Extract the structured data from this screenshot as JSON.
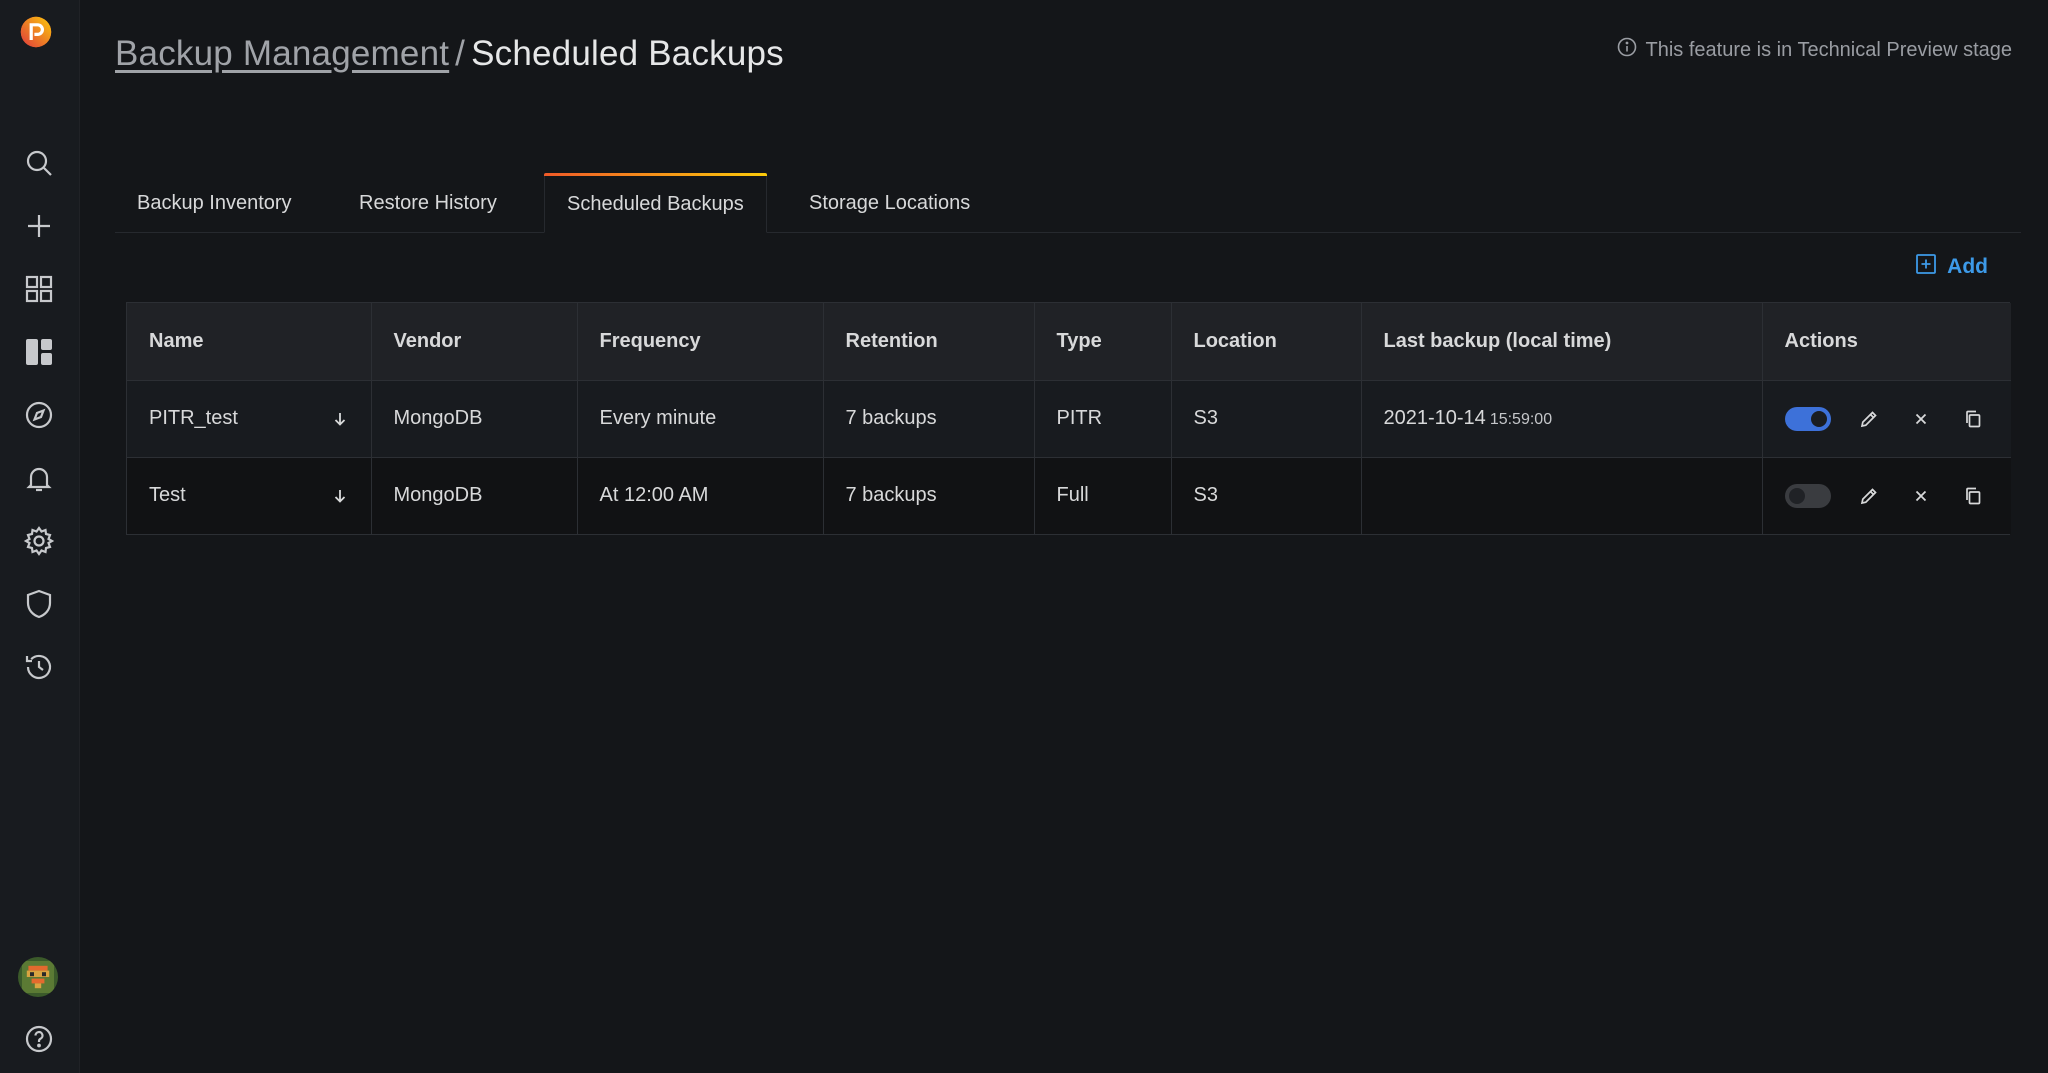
{
  "header": {
    "breadcrumb_parent": "Backup Management",
    "separator": "/",
    "title": "Scheduled Backups",
    "preview_note": "This feature is in Technical Preview stage"
  },
  "tabs": [
    {
      "label": "Backup Inventory",
      "active": false
    },
    {
      "label": "Restore History",
      "active": false
    },
    {
      "label": "Scheduled Backups",
      "active": true
    },
    {
      "label": "Storage Locations",
      "active": false
    }
  ],
  "add_button": {
    "label": "Add"
  },
  "table": {
    "columns": [
      "Name",
      "Vendor",
      "Frequency",
      "Retention",
      "Type",
      "Location",
      "Last backup (local time)",
      "Actions"
    ],
    "rows": [
      {
        "name": "PITR_test",
        "vendor": "MongoDB",
        "frequency": "Every minute",
        "retention": "7 backups",
        "type": "PITR",
        "location": "S3",
        "last_backup_date": "2021-10-14",
        "last_backup_time": "15:59:00",
        "enabled": true
      },
      {
        "name": "Test",
        "vendor": "MongoDB",
        "frequency": "At 12:00 AM",
        "retention": "7 backups",
        "type": "Full",
        "location": "S3",
        "last_backup_date": "",
        "last_backup_time": "",
        "enabled": false
      }
    ]
  },
  "sidebar": {
    "icons": [
      "logo-icon",
      "search-icon",
      "plus-icon",
      "dashboards-icon",
      "pmm-dashboard-icon",
      "explore-icon",
      "alerting-icon",
      "settings-icon",
      "shield-icon",
      "backup-history-icon",
      "avatar",
      "help-icon"
    ]
  },
  "colors": {
    "accent": "#3d9ae8",
    "toggle_on": "#3d71d9",
    "tab_gradient_start": "#f05a28",
    "tab_gradient_end": "#fbca0a",
    "background": "#141619"
  }
}
